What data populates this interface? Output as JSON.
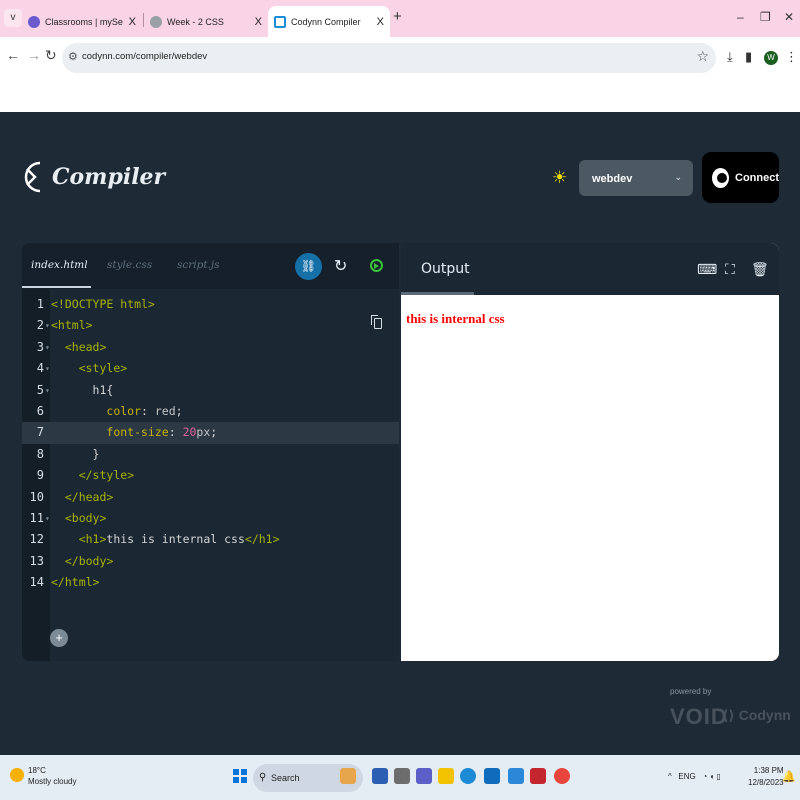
{
  "browser": {
    "tabs": [
      {
        "title": "Classrooms | mySecondTeacher",
        "close": "X"
      },
      {
        "title": "Week - 2 CSS",
        "close": "X"
      },
      {
        "title": "Codynn Compiler",
        "close": "X"
      }
    ],
    "new_tab": "+",
    "url": "codynn.com/compiler/webdev",
    "profile_initial": "W"
  },
  "app": {
    "logo_name": "Compiler",
    "language_select": "webdev",
    "connect_label": "Connect"
  },
  "editor": {
    "tabs": [
      "index.html",
      "style.css",
      "script.js"
    ],
    "active_tab": "index.html",
    "lines": [
      {
        "n": "1",
        "text": "<!DOCTYPE html>"
      },
      {
        "n": "2",
        "text": "<html>"
      },
      {
        "n": "3",
        "text": "  <head>"
      },
      {
        "n": "4",
        "text": "    <style>"
      },
      {
        "n": "5",
        "text": "      h1{"
      },
      {
        "n": "6",
        "text": "        color: red;"
      },
      {
        "n": "7",
        "text": "        font-size: 20px;"
      },
      {
        "n": "8",
        "text": "      }"
      },
      {
        "n": "9",
        "text": "    </style>"
      },
      {
        "n": "10",
        "text": "  </head>"
      },
      {
        "n": "11",
        "text": "  <body>"
      },
      {
        "n": "12",
        "text": "    <h1>this is internal css</h1>"
      },
      {
        "n": "13",
        "text": "  </body>"
      },
      {
        "n": "14",
        "text": "</html>"
      }
    ],
    "highlighted_line": "7"
  },
  "output": {
    "tab_label": "Output",
    "rendered_h1": "this is internal css",
    "rendered_color": "#ff0000"
  },
  "watermark": {
    "powered_by": "powered by",
    "void": "VOID",
    "codynn": "Codynn"
  },
  "taskbar": {
    "temperature": "18°C",
    "weather": "Mostly cloudy",
    "search_label": "Search",
    "language": "ENG",
    "time": "1:38 PM",
    "date": "12/8/2023"
  },
  "colors": {
    "app_bg": "#1e2a35",
    "tab_bar_bg": "#f9d3e6",
    "output_text": "#ff0000",
    "run_green": "#3ac23a",
    "share_blue": "#1670a8"
  }
}
